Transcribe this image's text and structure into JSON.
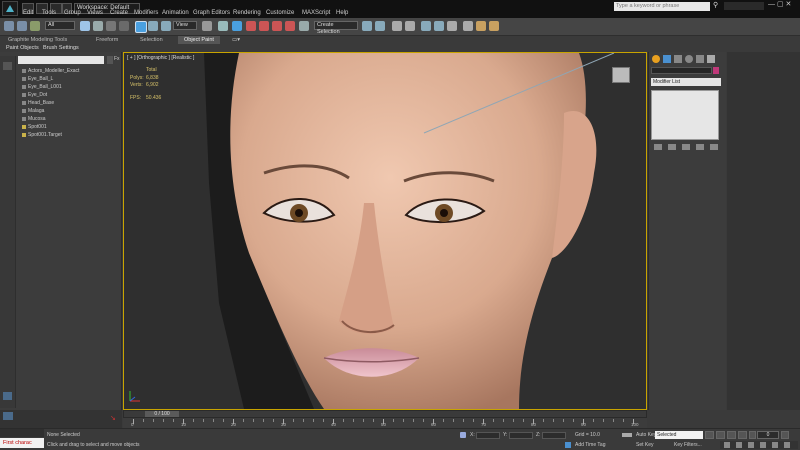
{
  "title_bar": {
    "workspace_label": "Workspace: Default",
    "search_placeholder": "Type a keyword or phrase"
  },
  "menu": [
    "Edit",
    "Tools",
    "Group",
    "Views",
    "Create",
    "Modifiers",
    "Animation",
    "Graph Editors",
    "Rendering",
    "Customize",
    "MAXScript",
    "Help"
  ],
  "toolbar": {
    "selection_filter": "All",
    "reference_coord": "View",
    "named_selection": "Create Selection"
  },
  "ribbon": {
    "tabs": [
      "Graphite Modeling Tools",
      "Freeform",
      "Selection",
      "Object Paint"
    ],
    "sub_items": [
      "Paint Objects",
      "Brush Settings"
    ]
  },
  "scene_explorer": {
    "items": [
      "Actors_Modeller_Exact",
      "Eye_Ball_L",
      "Eye_Ball_L001",
      "Eye_Dot",
      "Head_Base",
      "Malaga",
      "Mucosa",
      "Spot001",
      "Spot001.Target"
    ]
  },
  "viewport": {
    "label": "[ + ] [Orthographic ] [Realistic ]",
    "stats": {
      "total_label": "Total",
      "polys_label": "Polys:",
      "polys_value": "6,838",
      "verts_label": "Verts:",
      "verts_value": "6,902",
      "fps_label": "FPS:",
      "fps_value": "50.436"
    }
  },
  "command_panel": {
    "modifier_list": "Modifier List"
  },
  "timeline": {
    "slider_label": "0 / 100",
    "ticks": [
      "0",
      "10",
      "20",
      "30",
      "40",
      "50",
      "60",
      "70",
      "80",
      "90",
      "100"
    ]
  },
  "status": {
    "maxscript_label": "First charac",
    "selection_status": "None Selected",
    "prompt": "Click and drag to select and move objects",
    "x_label": "X:",
    "y_label": "Y:",
    "z_label": "Z:",
    "grid": "Grid = 10.0",
    "add_time_tag": "Add Time Tag",
    "auto_key": "Auto Key",
    "set_key": "Set Key",
    "selected_dropdown": "Selected",
    "key_filters": "Key Filters...",
    "current_frame": "0"
  },
  "colors": {
    "viewport_border": "#c8a400",
    "stat_text": "#d8c36a",
    "swatch": "#c0397a"
  }
}
